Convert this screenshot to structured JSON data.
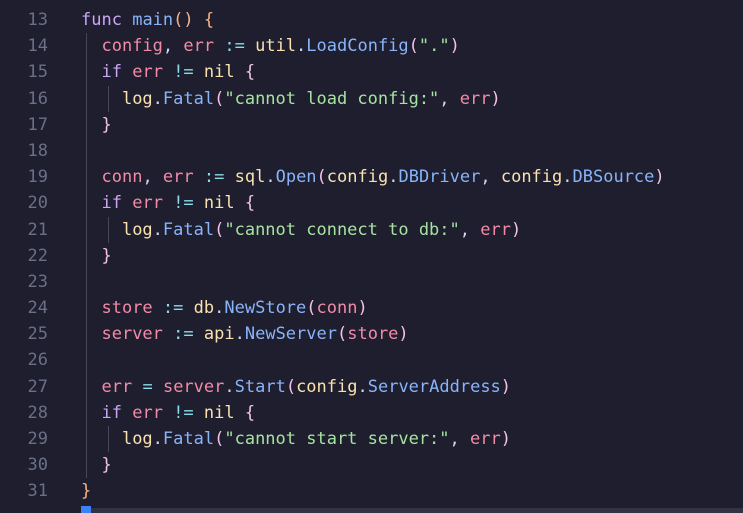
{
  "editor": {
    "language": "go",
    "theme_colors": {
      "keyword": "#cba6f7",
      "function": "#89b4fa",
      "variable": "#f38ba8",
      "package": "#f9e2af",
      "string": "#a6e3a1",
      "operator": "#89dceb",
      "plain": "#cdd6f4",
      "bracket_outer": "#fab387",
      "bracket_inner": "#f5c2e7",
      "line_number": "#6c7086"
    },
    "lines": [
      {
        "number": "13",
        "indent": 0,
        "tokens": [
          {
            "t": "func",
            "c": "keyword"
          },
          {
            "t": " ",
            "c": "plain"
          },
          {
            "t": "main",
            "c": "function"
          },
          {
            "t": "()",
            "c": "bracket_outer"
          },
          {
            "t": " ",
            "c": "plain"
          },
          {
            "t": "{",
            "c": "bracket_outer"
          }
        ]
      },
      {
        "number": "14",
        "indent": 1,
        "tokens": [
          {
            "t": "config",
            "c": "variable"
          },
          {
            "t": ", ",
            "c": "plain"
          },
          {
            "t": "err",
            "c": "variable"
          },
          {
            "t": " ",
            "c": "plain"
          },
          {
            "t": ":=",
            "c": "operator"
          },
          {
            "t": " ",
            "c": "plain"
          },
          {
            "t": "util",
            "c": "package"
          },
          {
            "t": ".",
            "c": "plain"
          },
          {
            "t": "LoadConfig",
            "c": "function"
          },
          {
            "t": "(",
            "c": "bracket_inner"
          },
          {
            "t": "\".\"",
            "c": "string"
          },
          {
            "t": ")",
            "c": "bracket_inner"
          }
        ]
      },
      {
        "number": "15",
        "indent": 1,
        "tokens": [
          {
            "t": "if",
            "c": "keyword"
          },
          {
            "t": " ",
            "c": "plain"
          },
          {
            "t": "err",
            "c": "variable"
          },
          {
            "t": " ",
            "c": "plain"
          },
          {
            "t": "!=",
            "c": "operator"
          },
          {
            "t": " ",
            "c": "plain"
          },
          {
            "t": "nil",
            "c": "package"
          },
          {
            "t": " ",
            "c": "plain"
          },
          {
            "t": "{",
            "c": "bracket_inner"
          }
        ]
      },
      {
        "number": "16",
        "indent": 2,
        "tokens": [
          {
            "t": "log",
            "c": "package"
          },
          {
            "t": ".",
            "c": "plain"
          },
          {
            "t": "Fatal",
            "c": "function"
          },
          {
            "t": "(",
            "c": "bracket_inner"
          },
          {
            "t": "\"cannot load config:\"",
            "c": "string"
          },
          {
            "t": ", ",
            "c": "plain"
          },
          {
            "t": "err",
            "c": "variable"
          },
          {
            "t": ")",
            "c": "bracket_inner"
          }
        ]
      },
      {
        "number": "17",
        "indent": 1,
        "tokens": [
          {
            "t": "}",
            "c": "bracket_inner"
          }
        ]
      },
      {
        "number": "18",
        "indent": 1,
        "tokens": []
      },
      {
        "number": "19",
        "indent": 1,
        "tokens": [
          {
            "t": "conn",
            "c": "variable"
          },
          {
            "t": ", ",
            "c": "plain"
          },
          {
            "t": "err",
            "c": "variable"
          },
          {
            "t": " ",
            "c": "plain"
          },
          {
            "t": ":=",
            "c": "operator"
          },
          {
            "t": " ",
            "c": "plain"
          },
          {
            "t": "sql",
            "c": "package"
          },
          {
            "t": ".",
            "c": "plain"
          },
          {
            "t": "Open",
            "c": "function"
          },
          {
            "t": "(",
            "c": "bracket_inner"
          },
          {
            "t": "config",
            "c": "package"
          },
          {
            "t": ".",
            "c": "plain"
          },
          {
            "t": "DBDriver",
            "c": "function"
          },
          {
            "t": ", ",
            "c": "plain"
          },
          {
            "t": "config",
            "c": "package"
          },
          {
            "t": ".",
            "c": "plain"
          },
          {
            "t": "DBSource",
            "c": "function"
          },
          {
            "t": ")",
            "c": "bracket_inner"
          }
        ]
      },
      {
        "number": "20",
        "indent": 1,
        "tokens": [
          {
            "t": "if",
            "c": "keyword"
          },
          {
            "t": " ",
            "c": "plain"
          },
          {
            "t": "err",
            "c": "variable"
          },
          {
            "t": " ",
            "c": "plain"
          },
          {
            "t": "!=",
            "c": "operator"
          },
          {
            "t": " ",
            "c": "plain"
          },
          {
            "t": "nil",
            "c": "package"
          },
          {
            "t": " ",
            "c": "plain"
          },
          {
            "t": "{",
            "c": "bracket_inner"
          }
        ]
      },
      {
        "number": "21",
        "indent": 2,
        "tokens": [
          {
            "t": "log",
            "c": "package"
          },
          {
            "t": ".",
            "c": "plain"
          },
          {
            "t": "Fatal",
            "c": "function"
          },
          {
            "t": "(",
            "c": "bracket_inner"
          },
          {
            "t": "\"cannot connect to db:\"",
            "c": "string"
          },
          {
            "t": ", ",
            "c": "plain"
          },
          {
            "t": "err",
            "c": "variable"
          },
          {
            "t": ")",
            "c": "bracket_inner"
          }
        ]
      },
      {
        "number": "22",
        "indent": 1,
        "tokens": [
          {
            "t": "}",
            "c": "bracket_inner"
          }
        ]
      },
      {
        "number": "23",
        "indent": 1,
        "tokens": []
      },
      {
        "number": "24",
        "indent": 1,
        "tokens": [
          {
            "t": "store",
            "c": "variable"
          },
          {
            "t": " ",
            "c": "plain"
          },
          {
            "t": ":=",
            "c": "operator"
          },
          {
            "t": " ",
            "c": "plain"
          },
          {
            "t": "db",
            "c": "package"
          },
          {
            "t": ".",
            "c": "plain"
          },
          {
            "t": "NewStore",
            "c": "function"
          },
          {
            "t": "(",
            "c": "bracket_inner"
          },
          {
            "t": "conn",
            "c": "variable"
          },
          {
            "t": ")",
            "c": "bracket_inner"
          }
        ]
      },
      {
        "number": "25",
        "indent": 1,
        "tokens": [
          {
            "t": "server",
            "c": "variable"
          },
          {
            "t": " ",
            "c": "plain"
          },
          {
            "t": ":=",
            "c": "operator"
          },
          {
            "t": " ",
            "c": "plain"
          },
          {
            "t": "api",
            "c": "package"
          },
          {
            "t": ".",
            "c": "plain"
          },
          {
            "t": "NewServer",
            "c": "function"
          },
          {
            "t": "(",
            "c": "bracket_inner"
          },
          {
            "t": "store",
            "c": "variable"
          },
          {
            "t": ")",
            "c": "bracket_inner"
          }
        ]
      },
      {
        "number": "26",
        "indent": 1,
        "tokens": []
      },
      {
        "number": "27",
        "indent": 1,
        "tokens": [
          {
            "t": "err",
            "c": "variable"
          },
          {
            "t": " ",
            "c": "plain"
          },
          {
            "t": "=",
            "c": "operator"
          },
          {
            "t": " ",
            "c": "plain"
          },
          {
            "t": "server",
            "c": "variable"
          },
          {
            "t": ".",
            "c": "plain"
          },
          {
            "t": "Start",
            "c": "function"
          },
          {
            "t": "(",
            "c": "bracket_inner"
          },
          {
            "t": "config",
            "c": "package"
          },
          {
            "t": ".",
            "c": "plain"
          },
          {
            "t": "ServerAddress",
            "c": "function"
          },
          {
            "t": ")",
            "c": "bracket_inner"
          }
        ]
      },
      {
        "number": "28",
        "indent": 1,
        "tokens": [
          {
            "t": "if",
            "c": "keyword"
          },
          {
            "t": " ",
            "c": "plain"
          },
          {
            "t": "err",
            "c": "variable"
          },
          {
            "t": " ",
            "c": "plain"
          },
          {
            "t": "!=",
            "c": "operator"
          },
          {
            "t": " ",
            "c": "plain"
          },
          {
            "t": "nil",
            "c": "package"
          },
          {
            "t": " ",
            "c": "plain"
          },
          {
            "t": "{",
            "c": "bracket_inner"
          }
        ]
      },
      {
        "number": "29",
        "indent": 2,
        "tokens": [
          {
            "t": "log",
            "c": "package"
          },
          {
            "t": ".",
            "c": "plain"
          },
          {
            "t": "Fatal",
            "c": "function"
          },
          {
            "t": "(",
            "c": "bracket_inner"
          },
          {
            "t": "\"cannot start server:\"",
            "c": "string"
          },
          {
            "t": ", ",
            "c": "plain"
          },
          {
            "t": "err",
            "c": "variable"
          },
          {
            "t": ")",
            "c": "bracket_inner"
          }
        ]
      },
      {
        "number": "30",
        "indent": 1,
        "tokens": [
          {
            "t": "}",
            "c": "bracket_inner"
          }
        ]
      },
      {
        "number": "31",
        "indent": 0,
        "tokens": [
          {
            "t": "}",
            "c": "bracket_outer"
          }
        ]
      }
    ]
  }
}
